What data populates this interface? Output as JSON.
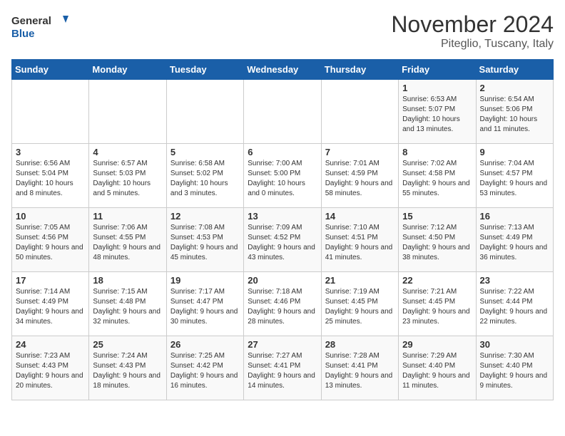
{
  "logo": {
    "line1": "General",
    "line2": "Blue"
  },
  "title": "November 2024",
  "subtitle": "Piteglio, Tuscany, Italy",
  "weekdays": [
    "Sunday",
    "Monday",
    "Tuesday",
    "Wednesday",
    "Thursday",
    "Friday",
    "Saturday"
  ],
  "weeks": [
    [
      {
        "day": "",
        "info": ""
      },
      {
        "day": "",
        "info": ""
      },
      {
        "day": "",
        "info": ""
      },
      {
        "day": "",
        "info": ""
      },
      {
        "day": "",
        "info": ""
      },
      {
        "day": "1",
        "info": "Sunrise: 6:53 AM\nSunset: 5:07 PM\nDaylight: 10 hours and 13 minutes."
      },
      {
        "day": "2",
        "info": "Sunrise: 6:54 AM\nSunset: 5:06 PM\nDaylight: 10 hours and 11 minutes."
      }
    ],
    [
      {
        "day": "3",
        "info": "Sunrise: 6:56 AM\nSunset: 5:04 PM\nDaylight: 10 hours and 8 minutes."
      },
      {
        "day": "4",
        "info": "Sunrise: 6:57 AM\nSunset: 5:03 PM\nDaylight: 10 hours and 5 minutes."
      },
      {
        "day": "5",
        "info": "Sunrise: 6:58 AM\nSunset: 5:02 PM\nDaylight: 10 hours and 3 minutes."
      },
      {
        "day": "6",
        "info": "Sunrise: 7:00 AM\nSunset: 5:00 PM\nDaylight: 10 hours and 0 minutes."
      },
      {
        "day": "7",
        "info": "Sunrise: 7:01 AM\nSunset: 4:59 PM\nDaylight: 9 hours and 58 minutes."
      },
      {
        "day": "8",
        "info": "Sunrise: 7:02 AM\nSunset: 4:58 PM\nDaylight: 9 hours and 55 minutes."
      },
      {
        "day": "9",
        "info": "Sunrise: 7:04 AM\nSunset: 4:57 PM\nDaylight: 9 hours and 53 minutes."
      }
    ],
    [
      {
        "day": "10",
        "info": "Sunrise: 7:05 AM\nSunset: 4:56 PM\nDaylight: 9 hours and 50 minutes."
      },
      {
        "day": "11",
        "info": "Sunrise: 7:06 AM\nSunset: 4:55 PM\nDaylight: 9 hours and 48 minutes."
      },
      {
        "day": "12",
        "info": "Sunrise: 7:08 AM\nSunset: 4:53 PM\nDaylight: 9 hours and 45 minutes."
      },
      {
        "day": "13",
        "info": "Sunrise: 7:09 AM\nSunset: 4:52 PM\nDaylight: 9 hours and 43 minutes."
      },
      {
        "day": "14",
        "info": "Sunrise: 7:10 AM\nSunset: 4:51 PM\nDaylight: 9 hours and 41 minutes."
      },
      {
        "day": "15",
        "info": "Sunrise: 7:12 AM\nSunset: 4:50 PM\nDaylight: 9 hours and 38 minutes."
      },
      {
        "day": "16",
        "info": "Sunrise: 7:13 AM\nSunset: 4:49 PM\nDaylight: 9 hours and 36 minutes."
      }
    ],
    [
      {
        "day": "17",
        "info": "Sunrise: 7:14 AM\nSunset: 4:49 PM\nDaylight: 9 hours and 34 minutes."
      },
      {
        "day": "18",
        "info": "Sunrise: 7:15 AM\nSunset: 4:48 PM\nDaylight: 9 hours and 32 minutes."
      },
      {
        "day": "19",
        "info": "Sunrise: 7:17 AM\nSunset: 4:47 PM\nDaylight: 9 hours and 30 minutes."
      },
      {
        "day": "20",
        "info": "Sunrise: 7:18 AM\nSunset: 4:46 PM\nDaylight: 9 hours and 28 minutes."
      },
      {
        "day": "21",
        "info": "Sunrise: 7:19 AM\nSunset: 4:45 PM\nDaylight: 9 hours and 25 minutes."
      },
      {
        "day": "22",
        "info": "Sunrise: 7:21 AM\nSunset: 4:45 PM\nDaylight: 9 hours and 23 minutes."
      },
      {
        "day": "23",
        "info": "Sunrise: 7:22 AM\nSunset: 4:44 PM\nDaylight: 9 hours and 22 minutes."
      }
    ],
    [
      {
        "day": "24",
        "info": "Sunrise: 7:23 AM\nSunset: 4:43 PM\nDaylight: 9 hours and 20 minutes."
      },
      {
        "day": "25",
        "info": "Sunrise: 7:24 AM\nSunset: 4:43 PM\nDaylight: 9 hours and 18 minutes."
      },
      {
        "day": "26",
        "info": "Sunrise: 7:25 AM\nSunset: 4:42 PM\nDaylight: 9 hours and 16 minutes."
      },
      {
        "day": "27",
        "info": "Sunrise: 7:27 AM\nSunset: 4:41 PM\nDaylight: 9 hours and 14 minutes."
      },
      {
        "day": "28",
        "info": "Sunrise: 7:28 AM\nSunset: 4:41 PM\nDaylight: 9 hours and 13 minutes."
      },
      {
        "day": "29",
        "info": "Sunrise: 7:29 AM\nSunset: 4:40 PM\nDaylight: 9 hours and 11 minutes."
      },
      {
        "day": "30",
        "info": "Sunrise: 7:30 AM\nSunset: 4:40 PM\nDaylight: 9 hours and 9 minutes."
      }
    ]
  ]
}
